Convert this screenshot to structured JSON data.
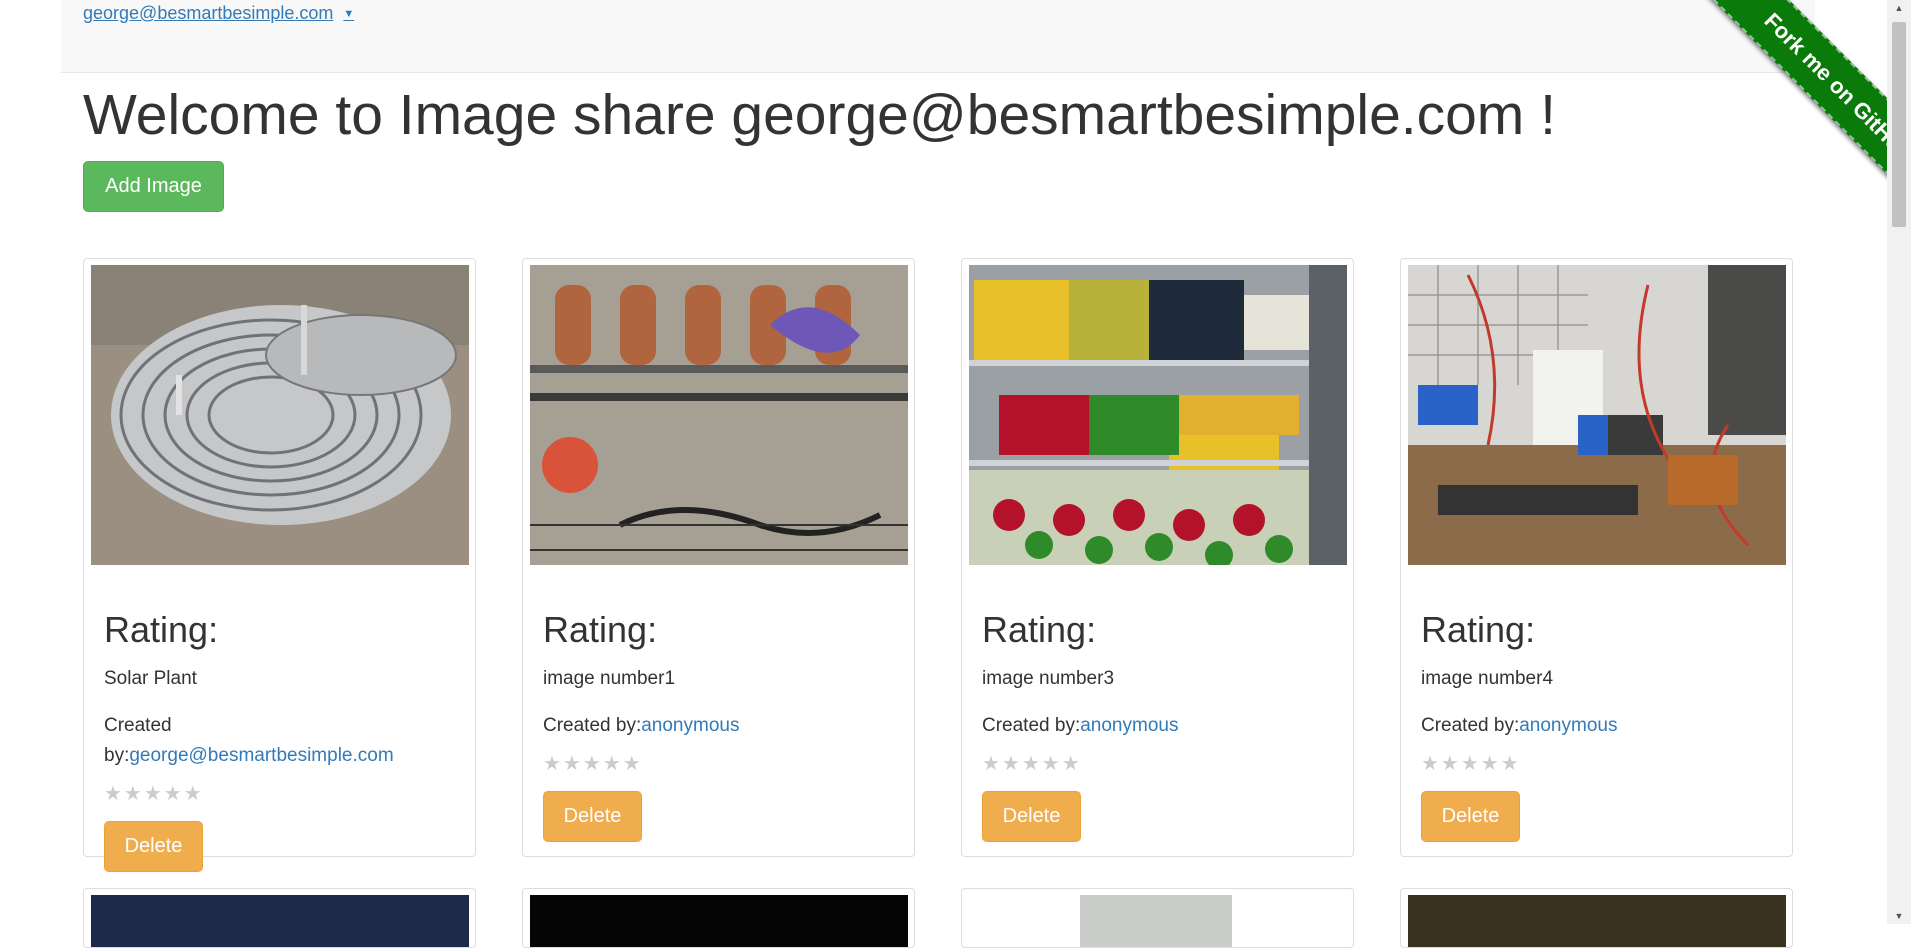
{
  "navbar": {
    "user_email": "george@besmartbesimple.com",
    "caret": "▼"
  },
  "page": {
    "welcome_title": "Welcome to Image share george@besmartbesimple.com !",
    "add_button": "Add Image"
  },
  "ribbon": {
    "label": "Fork me on GitHub",
    "color": "#0a7a0a"
  },
  "cards": [
    {
      "rating_label": "Rating:",
      "name": "Solar Plant",
      "created_prefix": "Created by:",
      "created_by": "george@besmartbesimple.com",
      "stars": "★★★★★",
      "delete_label": "Delete"
    },
    {
      "rating_label": "Rating:",
      "name": "image number1",
      "created_prefix": "Created by:",
      "created_by": "anonymous",
      "stars": "★★★★★",
      "delete_label": "Delete"
    },
    {
      "rating_label": "Rating:",
      "name": "image number3",
      "created_prefix": "Created by:",
      "created_by": "anonymous",
      "stars": "★★★★★",
      "delete_label": "Delete"
    },
    {
      "rating_label": "Rating:",
      "name": "image number4",
      "created_prefix": "Created by:",
      "created_by": "anonymous",
      "stars": "★★★★★",
      "delete_label": "Delete"
    }
  ],
  "colors": {
    "link": "#337ab7",
    "add_button": "#5cb85c",
    "delete_button": "#f0ad4e"
  }
}
